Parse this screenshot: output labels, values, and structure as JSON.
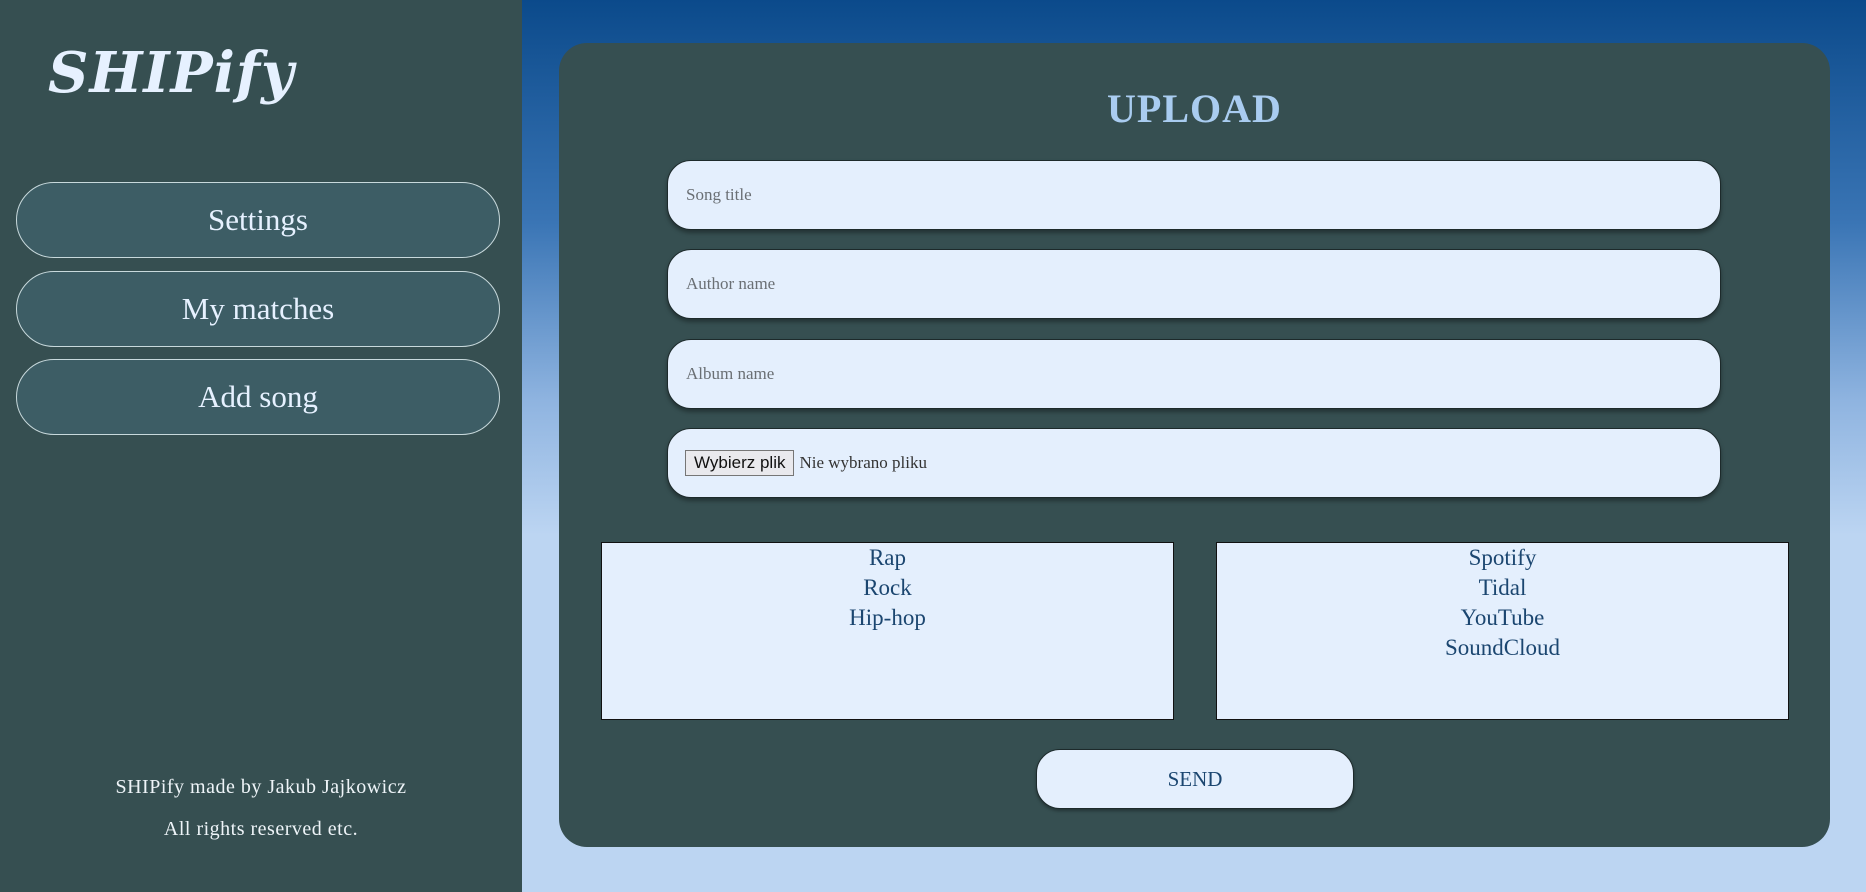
{
  "app": {
    "logo": "SHIPify"
  },
  "sidebar": {
    "items": [
      {
        "label": "Settings"
      },
      {
        "label": "My matches"
      },
      {
        "label": "Add song"
      }
    ],
    "footer": {
      "line1": "SHIPify made by Jakub Jajkowicz",
      "line2": "All rights reserved etc."
    }
  },
  "upload": {
    "title": "UPLOAD",
    "song_title_placeholder": "Song title",
    "author_placeholder": "Author name",
    "album_placeholder": "Album name",
    "file_button": "Wybierz plik",
    "file_status": "Nie wybrano pliku",
    "genres": [
      "Rap",
      "Rock",
      "Hip-hop"
    ],
    "platforms": [
      "Spotify",
      "Tidal",
      "YouTube",
      "SoundCloud"
    ],
    "send_label": "SEND"
  },
  "colors": {
    "sidebar_bg": "#364f51",
    "panel_bg": "#364f51",
    "field_bg": "#e4effd",
    "title_color": "#a9ccf0",
    "option_text": "#1b4670"
  }
}
